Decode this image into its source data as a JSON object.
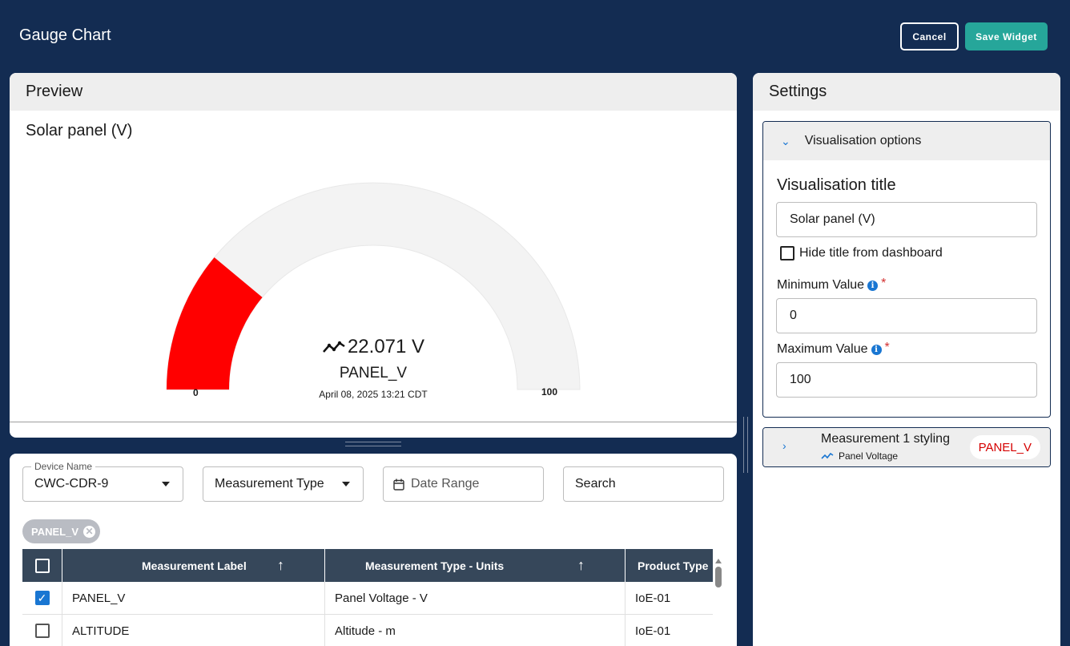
{
  "header": {
    "title": "Gauge Chart",
    "cancel_label": "Cancel",
    "save_label": "Save Widget"
  },
  "preview": {
    "heading": "Preview",
    "chart_title": "Solar panel (V)",
    "gauge": {
      "value_text": "22.071 V",
      "label": "PANEL_V",
      "timestamp": "April 08, 2025 13:21 CDT",
      "min_label": "0",
      "max_label": "100"
    }
  },
  "chart_data": {
    "type": "gauge",
    "title": "Solar panel (V)",
    "value": 22.071,
    "unit": "V",
    "min": 0,
    "max": 100,
    "series_name": "PANEL_V",
    "colors": {
      "fill": "#ff0000",
      "track": "#f3f3f3"
    }
  },
  "filters": {
    "device": {
      "legend": "Device Name",
      "value": "CWC-CDR-9"
    },
    "measurement_type": {
      "placeholder": "Measurement Type"
    },
    "date_range": {
      "placeholder": "Date Range"
    },
    "search": {
      "placeholder": "Search"
    }
  },
  "chips": [
    {
      "label": "PANEL_V"
    }
  ],
  "table": {
    "headers": [
      "Measurement Label",
      "Measurement Type - Units",
      "Product Type"
    ],
    "rows": [
      {
        "checked": true,
        "label": "PANEL_V",
        "type_units": "Panel Voltage - V",
        "product": "IoE-01"
      },
      {
        "checked": false,
        "label": "ALTITUDE",
        "type_units": "Altitude - m",
        "product": "IoE-01"
      }
    ]
  },
  "settings": {
    "heading": "Settings",
    "visualisation": {
      "section_label": "Visualisation options",
      "title_label": "Visualisation title",
      "title_value": "Solar panel (V)",
      "hide_title_label": "Hide title from dashboard",
      "min_label": "Minimum Value",
      "min_value": "0",
      "max_label": "Maximum Value",
      "max_value": "100"
    },
    "measurement_styling": {
      "section_label": "Measurement 1 styling",
      "sub_label": "Panel Voltage",
      "pill": "PANEL_V"
    }
  }
}
